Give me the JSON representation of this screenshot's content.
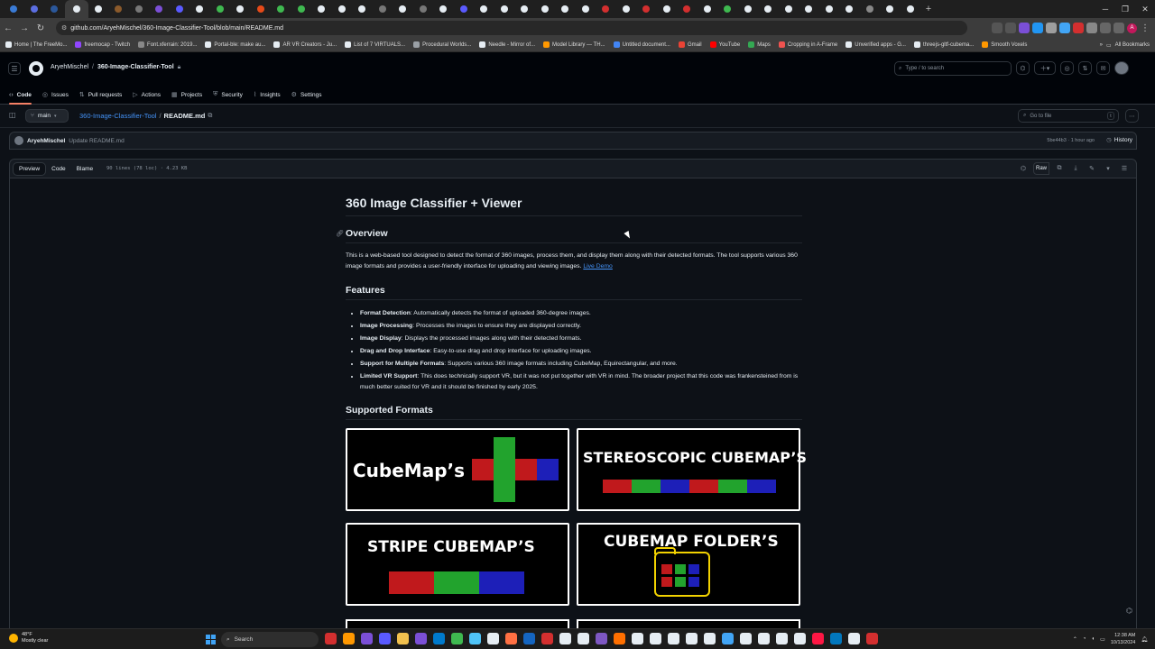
{
  "browser": {
    "url": "github.com/AryehMischel/360-Image-Classifier-Tool/blob/main/README.md",
    "tab_colors": [
      "#3a7bd5",
      "#5b6ee1",
      "#2b579a",
      "#e6edf3",
      "#e6edf3",
      "#8b5a2b",
      "#777",
      "#7b4fd6",
      "#5a5aff",
      "#e6edf3",
      "#3fb950",
      "#e6edf3",
      "#e64a19",
      "#3fb950",
      "#3fb950",
      "#e6edf3",
      "#e6edf3",
      "#e6edf3",
      "#777",
      "#e6edf3",
      "#777",
      "#e6edf3",
      "#5a5aff",
      "#e6edf3",
      "#e6edf3",
      "#e6edf3",
      "#e6edf3",
      "#e6edf3",
      "#e6edf3",
      "#d32f2f",
      "#e6edf3",
      "#d32f2f",
      "#e6edf3",
      "#d32f2f",
      "#e6edf3",
      "#3fb950",
      "#e6edf3",
      "#e6edf3",
      "#e6edf3",
      "#e6edf3",
      "#e6edf3",
      "#e6edf3",
      "#888",
      "#e6edf3",
      "#e6edf3"
    ],
    "bookmarks": [
      {
        "label": "Home | The FreeMo...",
        "color": "#e6edf3"
      },
      {
        "label": "freemocap - Twitch",
        "color": "#9146ff"
      },
      {
        "label": "Font.xferrain: 2019...",
        "color": "#888888"
      },
      {
        "label": "Portal-ble: make au...",
        "color": "#e6edf3"
      },
      {
        "label": "AR VR Creators - Ju...",
        "color": "#e6edf3"
      },
      {
        "label": "List of 7 VIRTUALS...",
        "color": "#e6edf3"
      },
      {
        "label": "Procedural Worlds...",
        "color": "#9aa0a6"
      },
      {
        "label": "Needle - Mirror of...",
        "color": "#e6edf3"
      },
      {
        "label": "Model Library — TH...",
        "color": "#ff9800"
      },
      {
        "label": "Untitled document...",
        "color": "#4285f4"
      },
      {
        "label": "Gmail",
        "color": "#ea4335"
      },
      {
        "label": "YouTube",
        "color": "#ff0000"
      },
      {
        "label": "Maps",
        "color": "#34a853"
      },
      {
        "label": "Cropping in A-Frame",
        "color": "#ef5350"
      },
      {
        "label": "Unverified apps - G...",
        "color": "#e6edf3"
      },
      {
        "label": "threejs-gltf-cubema...",
        "color": "#e6edf3"
      },
      {
        "label": "Smooth Voxels",
        "color": "#ff9800"
      }
    ],
    "all_bookmarks": "All Bookmarks",
    "profile_initial": "A"
  },
  "github": {
    "owner": "AryehMischel",
    "repo": "360-Image-Classifier-Tool",
    "search_placeholder": "Type / to search",
    "nav": [
      "Code",
      "Issues",
      "Pull requests",
      "Actions",
      "Projects",
      "Security",
      "Insights",
      "Settings"
    ],
    "branch": "main",
    "breadcrumb_repo": "360-Image-Classifier-Tool",
    "breadcrumb_sep": "/",
    "filename": "README.md",
    "goto_placeholder": "Go to file",
    "goto_key": "t",
    "commit_user": "AryehMischel",
    "commit_msg": "Update README.md",
    "commit_meta": "5be44b3 · 1 hour ago",
    "history": "History",
    "view_tabs": [
      "Preview",
      "Code",
      "Blame"
    ],
    "file_info": "90 lines (78 loc) · 4.23 KB",
    "raw": "Raw"
  },
  "readme": {
    "title": "360 Image Classifier + Viewer",
    "overview_heading": "Overview",
    "overview_text": "This is a web-based tool designed to detect the format of 360 images, process them, and display them along with their detected formats. The tool supports various 360 image formats and provides a user-friendly interface for uploading and viewing images.",
    "live_demo": "Live Demo",
    "features_heading": "Features",
    "features": [
      {
        "name": "Format Detection",
        "desc": ": Automatically detects the format of uploaded 360-degree images."
      },
      {
        "name": "Image Processing",
        "desc": ": Processes the images to ensure they are displayed correctly."
      },
      {
        "name": "Image Display",
        "desc": ": Displays the processed images along with their detected formats."
      },
      {
        "name": "Drag and Drop Interface",
        "desc": ": Easy-to-use drag and drop interface for uploading images."
      },
      {
        "name": "Support for Multiple Formats",
        "desc": ": Supports various 360 image formats including CubeMap, Equirectangular, and more."
      },
      {
        "name": "Limited VR Support",
        "desc": ": This does technically support VR, but it was not put together with VR in mind. The broader project that this code was frankensteined from is much better suited for VR and it should be finished by early 2025."
      }
    ],
    "formats_heading": "Supported Formats",
    "format_cards": [
      "CubeMap’s",
      "STEREOSCOPIC CUBEMAP’S",
      "STRIPE CUBEMAP’S",
      "CUBEMAP FOLDER’S"
    ]
  },
  "taskbar": {
    "temp": "48°F",
    "weather": "Mostly clear",
    "search": "Search",
    "time": "12:38 AM",
    "date": "10/13/2024",
    "app_colors": [
      "#d32f2f",
      "#ff9800",
      "#7b4fd6",
      "#5a5aff",
      "#f2c14e",
      "#7b4fd6",
      "#007acc",
      "#3fb950",
      "#4fc3f7",
      "#e6edf3",
      "#ff7043",
      "#1565c0",
      "#d32f2f",
      "#e6edf3",
      "#e6edf3",
      "#7e57c2",
      "#ff6f00",
      "#e6edf3",
      "#e6edf3",
      "#e6edf3",
      "#e6edf3",
      "#e6edf3",
      "#42a5f5",
      "#e6edf3",
      "#e6edf3",
      "#e6edf3",
      "#e6edf3",
      "#ff1744",
      "#0277bd",
      "#e6edf3",
      "#d32f2f"
    ]
  }
}
